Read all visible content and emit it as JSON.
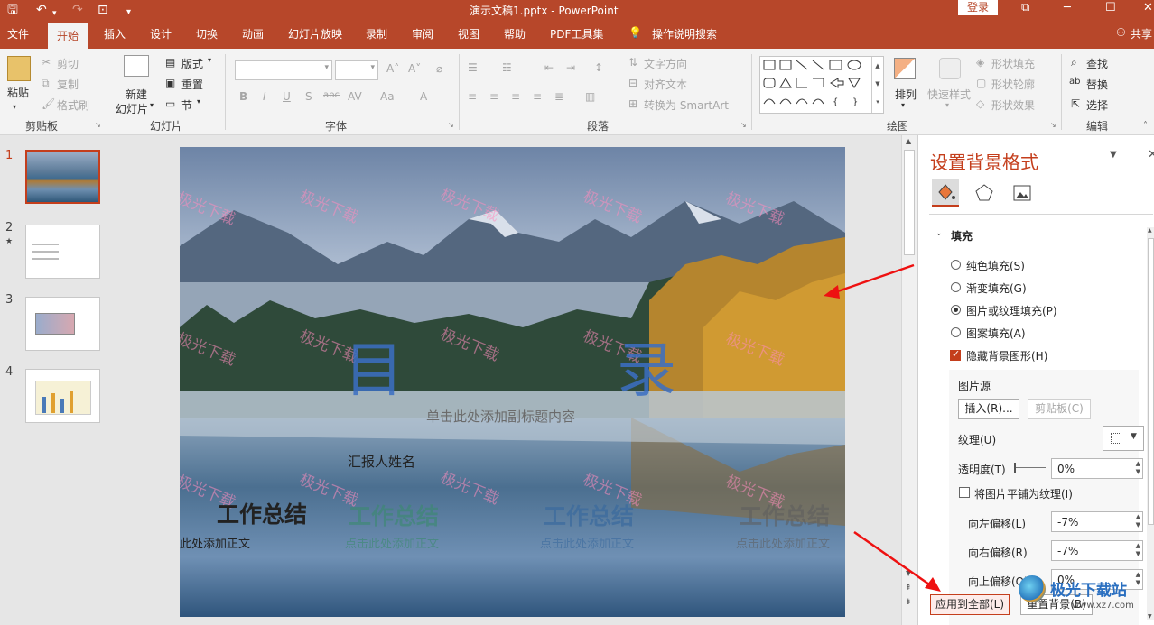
{
  "titlebar": {
    "doc_title": "演示文稿1.pptx  -  PowerPoint",
    "login": "登录"
  },
  "tabs": [
    "文件",
    "开始",
    "插入",
    "设计",
    "切换",
    "动画",
    "幻灯片放映",
    "录制",
    "审阅",
    "视图",
    "帮助",
    "PDF工具集",
    "操作说明搜索"
  ],
  "share": "共享",
  "ribbon": {
    "clipboard": {
      "paste": "粘贴",
      "cut": "剪切",
      "copy": "复制",
      "format": "格式刷",
      "group": "剪贴板"
    },
    "slides": {
      "new": "新建",
      "new2": "幻灯片",
      "layout": "版式",
      "reset": "重置",
      "section": "节",
      "group": "幻灯片"
    },
    "font": {
      "group": "字体"
    },
    "paragraph": {
      "text_dir": "文字方向",
      "align_text": "对齐文本",
      "smartart": "转换为 SmartArt",
      "group": "段落"
    },
    "drawing": {
      "arrange": "排列",
      "quick": "快速样式",
      "fill": "形状填充",
      "outline": "形状轮廓",
      "effect": "形状效果",
      "group": "绘图"
    },
    "editing": {
      "find": "查找",
      "replace": "替换",
      "select": "选择",
      "group": "编辑"
    }
  },
  "thumbs": [
    "1",
    "2",
    "3",
    "4"
  ],
  "slide": {
    "watermark": "极光下载",
    "toc_left": "目",
    "toc_right": "录",
    "subtitle": "单击此处添加副标题内容",
    "reporter": "汇报人姓名",
    "items": [
      "工作总结",
      "工作总结",
      "工作总结",
      "工作总结"
    ],
    "item_sub": "点击此处添加正文"
  },
  "panel": {
    "title": "设置背景格式",
    "section": "填充",
    "fill_options": [
      "纯色填充(S)",
      "渐变填充(G)",
      "图片或纹理填充(P)",
      "图案填充(A)"
    ],
    "hide_bg": "隐藏背景图形(H)",
    "pic_source": "图片源",
    "insert": "插入(R)...",
    "clipboard": "剪贴板(C)",
    "texture": "纹理(U)",
    "transparency": "透明度(T)",
    "transparency_value": "0%",
    "tile": "将图片平铺为纹理(I)",
    "offset_left": "向左偏移(L)",
    "offset_left_value": "-7%",
    "offset_right": "向右偏移(R)",
    "offset_right_value": "-7%",
    "offset_top": "向上偏移(O)",
    "offset_top_value": "0%",
    "apply_all": "应用到全部(L)",
    "reset_bg": "重置背景(B)"
  },
  "corner_watermark": "极光下载站",
  "corner_url": "www.xz7.com"
}
